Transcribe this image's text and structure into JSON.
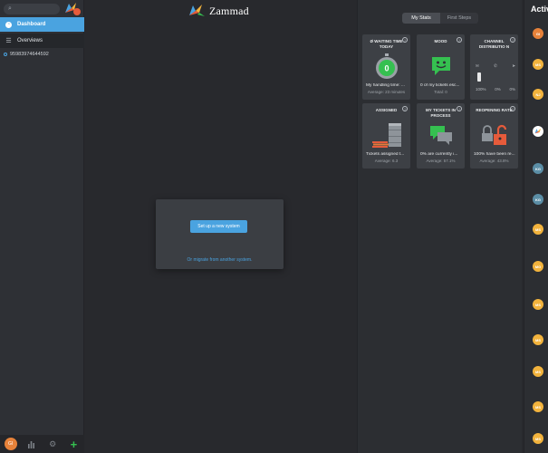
{
  "search": {
    "placeholder": ""
  },
  "sidebar": {
    "items": [
      {
        "label": "Dashboard"
      },
      {
        "label": "Overviews"
      }
    ],
    "open_tab": {
      "label": "95983974644592"
    },
    "user_initials": "GI"
  },
  "brand": {
    "name": "Zammad"
  },
  "setup": {
    "button_label": "Set up a new system",
    "migrate_label": "Or migrate from another system."
  },
  "stats": {
    "tabs": [
      "My Stats",
      "First Steps"
    ],
    "cards": {
      "waiting": {
        "title": "Ø WAITING TIME TODAY",
        "value": "0",
        "line1": "My handling time: ...",
        "line2": "Average: 23 minutes"
      },
      "mood": {
        "title": "MOOD",
        "line1": "0 of my tickets esc...",
        "line2": "Total: 0"
      },
      "channel": {
        "title": "CHANNEL DISTRIBUTIO N",
        "percents": [
          "100%",
          "0%",
          "0%"
        ]
      },
      "assigned": {
        "title": "ASSIGNED",
        "line1": "Tickets assigned t...",
        "line2": "Average: 6.3"
      },
      "process": {
        "title": "MY TICKETS IN PROCESS",
        "line1": "0% are currently i...",
        "line2": "Average: 57.1%"
      },
      "reopen": {
        "title": "REOPENING RATE",
        "line1": "100% have been re...",
        "line2": "Average: 43.8%"
      }
    },
    "help_glyph": "?"
  },
  "activity": {
    "title": "Activity",
    "avatars": [
      {
        "initials": "GI",
        "color": "#e7823a"
      },
      {
        "initials": "MS",
        "color": "#f2b33d"
      },
      {
        "initials": "NJ",
        "color": "#f2b33d"
      },
      {
        "initials": "",
        "color": "#ffffff",
        "logo": true
      },
      {
        "initials": "KG",
        "color": "#5b8ea6"
      },
      {
        "initials": "KG",
        "color": "#5b8ea6"
      },
      {
        "initials": "MS",
        "color": "#f2b33d"
      },
      {
        "initials": "MG",
        "color": "#f2b33d"
      },
      {
        "initials": "MS",
        "color": "#f2b33d"
      },
      {
        "initials": "MS",
        "color": "#f2b33d"
      },
      {
        "initials": "MS",
        "color": "#f2b33d"
      },
      {
        "initials": "MS",
        "color": "#f2b33d"
      },
      {
        "initials": "MS",
        "color": "#f2b33d"
      }
    ]
  },
  "colors": {
    "accent": "#4aa3e0",
    "sidebar_bg": "#2e3035",
    "main_bg": "#28292d",
    "card_bg": "#3d4045",
    "green": "#35c050",
    "orange": "#e65b3b"
  }
}
